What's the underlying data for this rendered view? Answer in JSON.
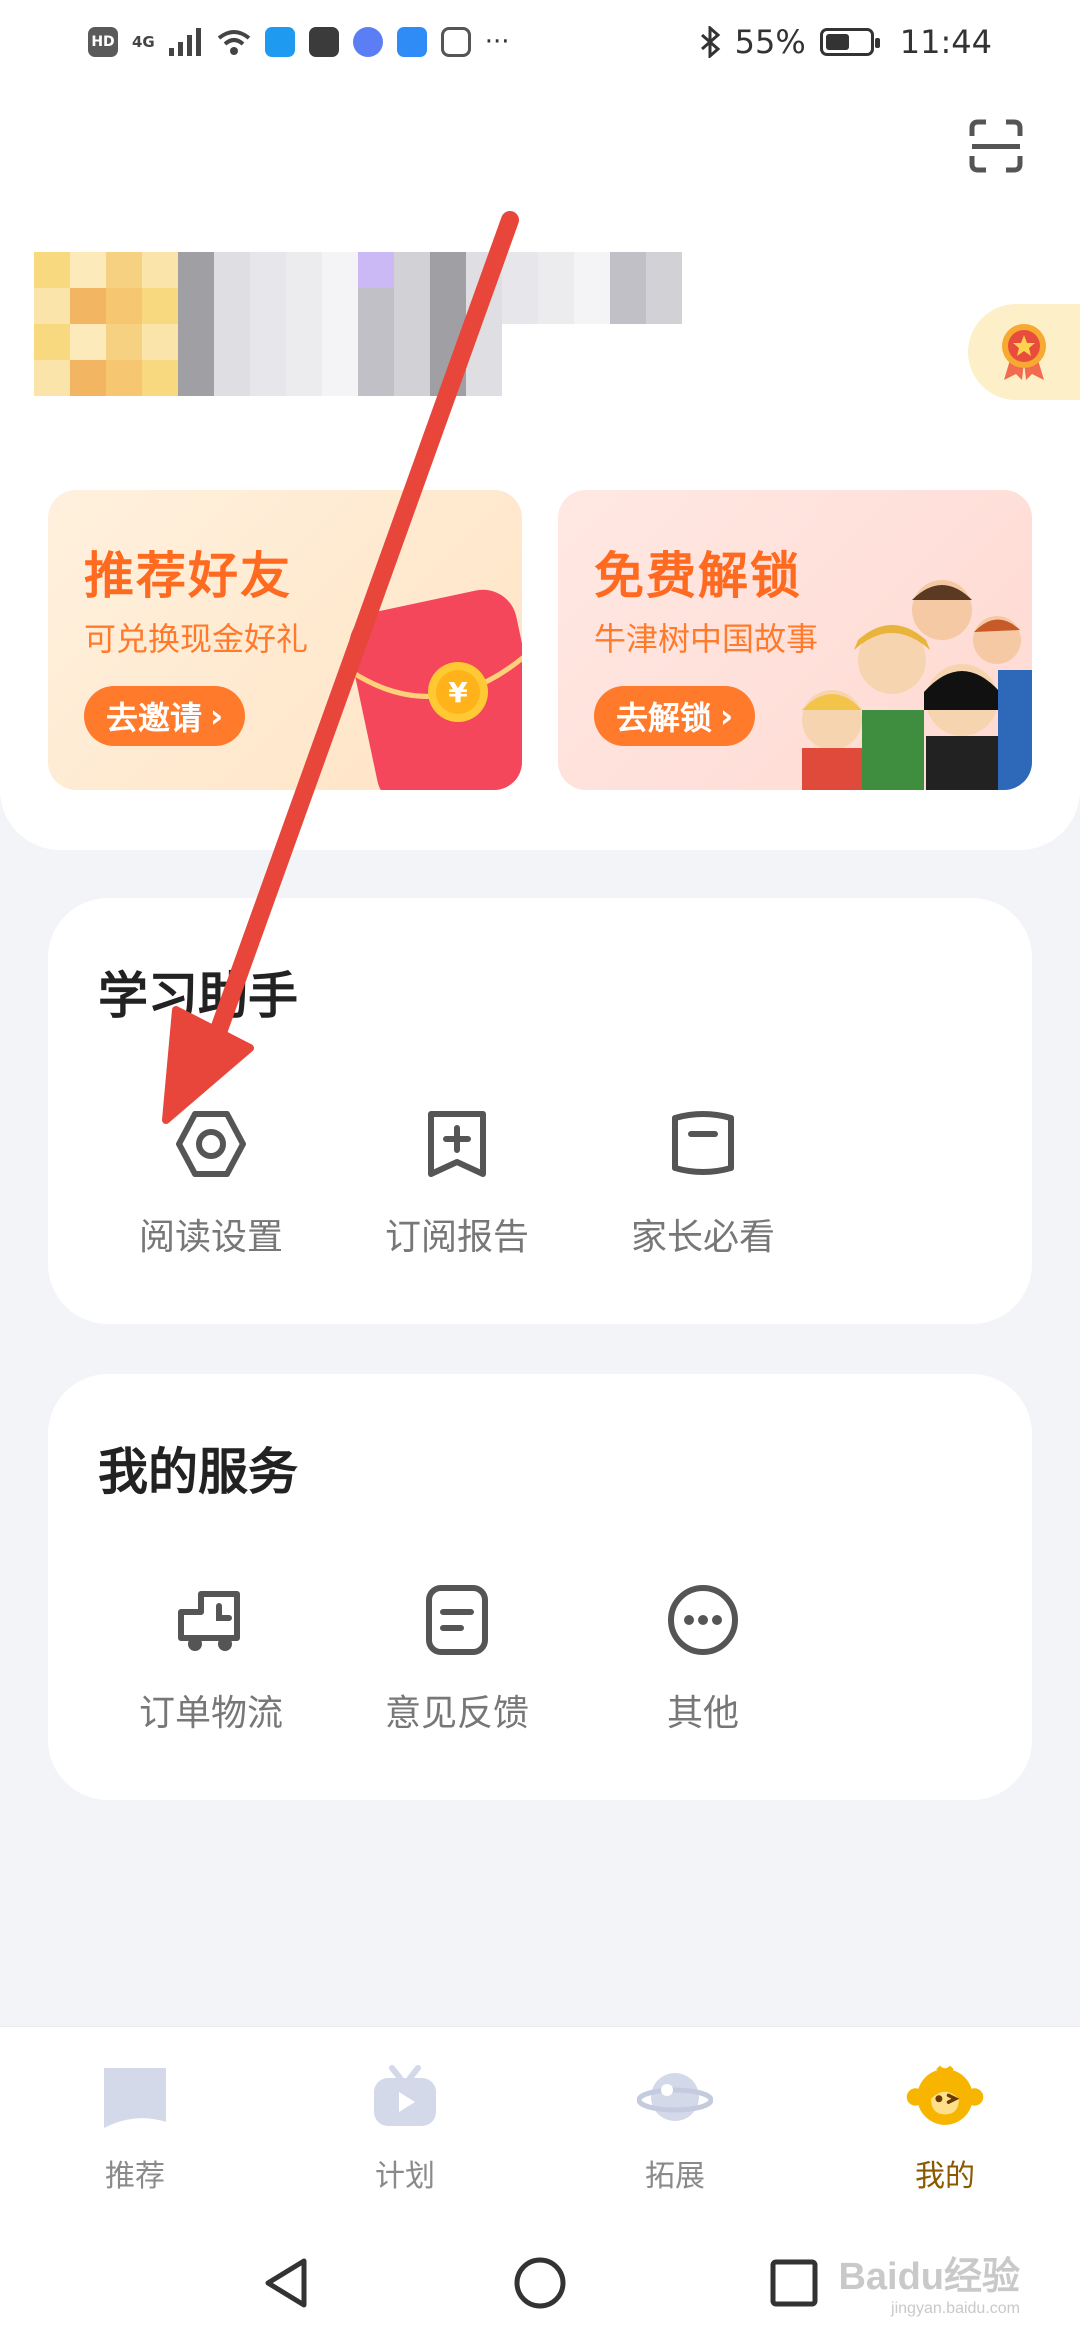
{
  "status_bar": {
    "network_chip": "HD",
    "network_type": "4G",
    "battery": "55%",
    "battery_level": 0.55,
    "time": "11:44",
    "more": "···",
    "icons": [
      "hd-icon",
      "signal-icon",
      "wifi-icon",
      "search-app-icon",
      "huawei-app-icon",
      "music-app-icon",
      "weather-app-icon",
      "hand-app-icon",
      "bluetooth-icon",
      "battery-icon"
    ]
  },
  "header": {
    "scan_icon": "scan-icon",
    "badge_icon": "medal-icon"
  },
  "promos": [
    {
      "title": "推荐好友",
      "subtitle": "可兑换现金好礼",
      "button": "去邀请",
      "accent": "#ff6a21"
    },
    {
      "title": "免费解锁",
      "subtitle": "牛津树中国故事",
      "button": "去解锁",
      "accent": "#ff6a21"
    }
  ],
  "study": {
    "title": "学习助手",
    "items": [
      {
        "label": "阅读设置",
        "icon": "settings-hex-icon"
      },
      {
        "label": "订阅报告",
        "icon": "bookmark-plus-icon"
      },
      {
        "label": "家长必看",
        "icon": "book-icon"
      }
    ]
  },
  "service": {
    "title": "我的服务",
    "items": [
      {
        "label": "订单物流",
        "icon": "delivery-truck-icon"
      },
      {
        "label": "意见反馈",
        "icon": "feedback-doc-icon"
      },
      {
        "label": "其他",
        "icon": "more-circle-icon"
      }
    ]
  },
  "bottom_nav": {
    "items": [
      {
        "label": "推荐",
        "active": false
      },
      {
        "label": "计划",
        "active": false
      },
      {
        "label": "拓展",
        "active": false
      },
      {
        "label": "我的",
        "active": true
      }
    ]
  },
  "watermark": {
    "text": "Baidu经验",
    "sub": "jingyan.baidu.com"
  },
  "colors": {
    "accent": "#ff7a2b",
    "active_nav": "#f7b500",
    "annotation_arrow": "#e8463a"
  }
}
